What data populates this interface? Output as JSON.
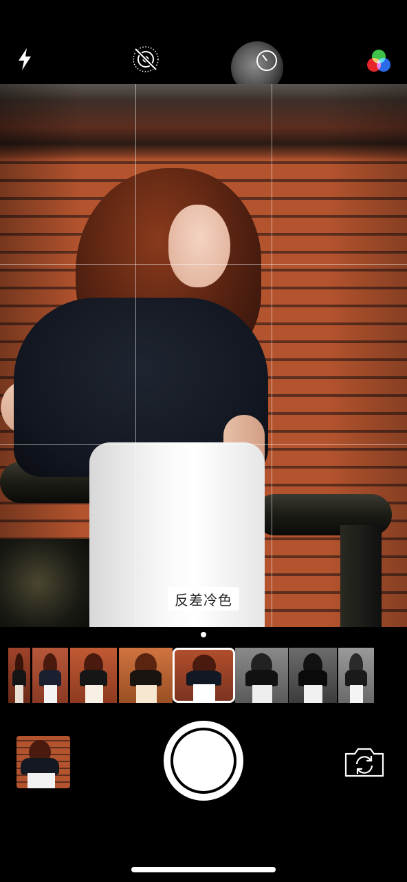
{
  "top_bar": {
    "icons": {
      "flash": "flash-icon",
      "live_photo": "live-photo-off-icon",
      "timer": "timer-icon",
      "filters": "color-filters-icon"
    }
  },
  "viewfinder": {
    "current_filter_label": "反差冷色",
    "grid": true
  },
  "filter_strip": {
    "selected_index": 4,
    "filters": [
      {
        "tone": "warm-dark"
      },
      {
        "tone": "natural"
      },
      {
        "tone": "vivid"
      },
      {
        "tone": "warm"
      },
      {
        "tone": "contrast-cool"
      },
      {
        "tone": "mono"
      },
      {
        "tone": "noir"
      },
      {
        "tone": "silvertone"
      }
    ]
  },
  "bottom_bar": {
    "icons": {
      "gallery": "gallery-thumbnail",
      "shutter": "shutter-button",
      "switch_camera": "switch-camera-icon"
    }
  }
}
